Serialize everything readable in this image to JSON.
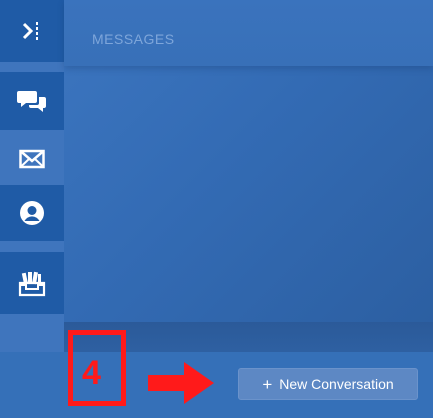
{
  "header": {
    "title": "MESSAGES"
  },
  "sidebar": {
    "items": [
      {
        "id": "toggle",
        "icon": "collapse-toggle-icon"
      },
      {
        "id": "chat",
        "icon": "chat-bubbles-icon"
      },
      {
        "id": "mail",
        "icon": "envelope-icon"
      },
      {
        "id": "profile",
        "icon": "user-profile-icon"
      },
      {
        "id": "inbox",
        "icon": "inbox-tray-icon"
      }
    ]
  },
  "footer": {
    "new_conversation_label": "New Conversation",
    "new_conversation_icon": "+"
  },
  "annotation": {
    "step_number": "4",
    "color": "#ff1a1a"
  },
  "colors": {
    "accent": "#1f5ba6",
    "background": "#336bb4",
    "button": "#5d88c4"
  }
}
